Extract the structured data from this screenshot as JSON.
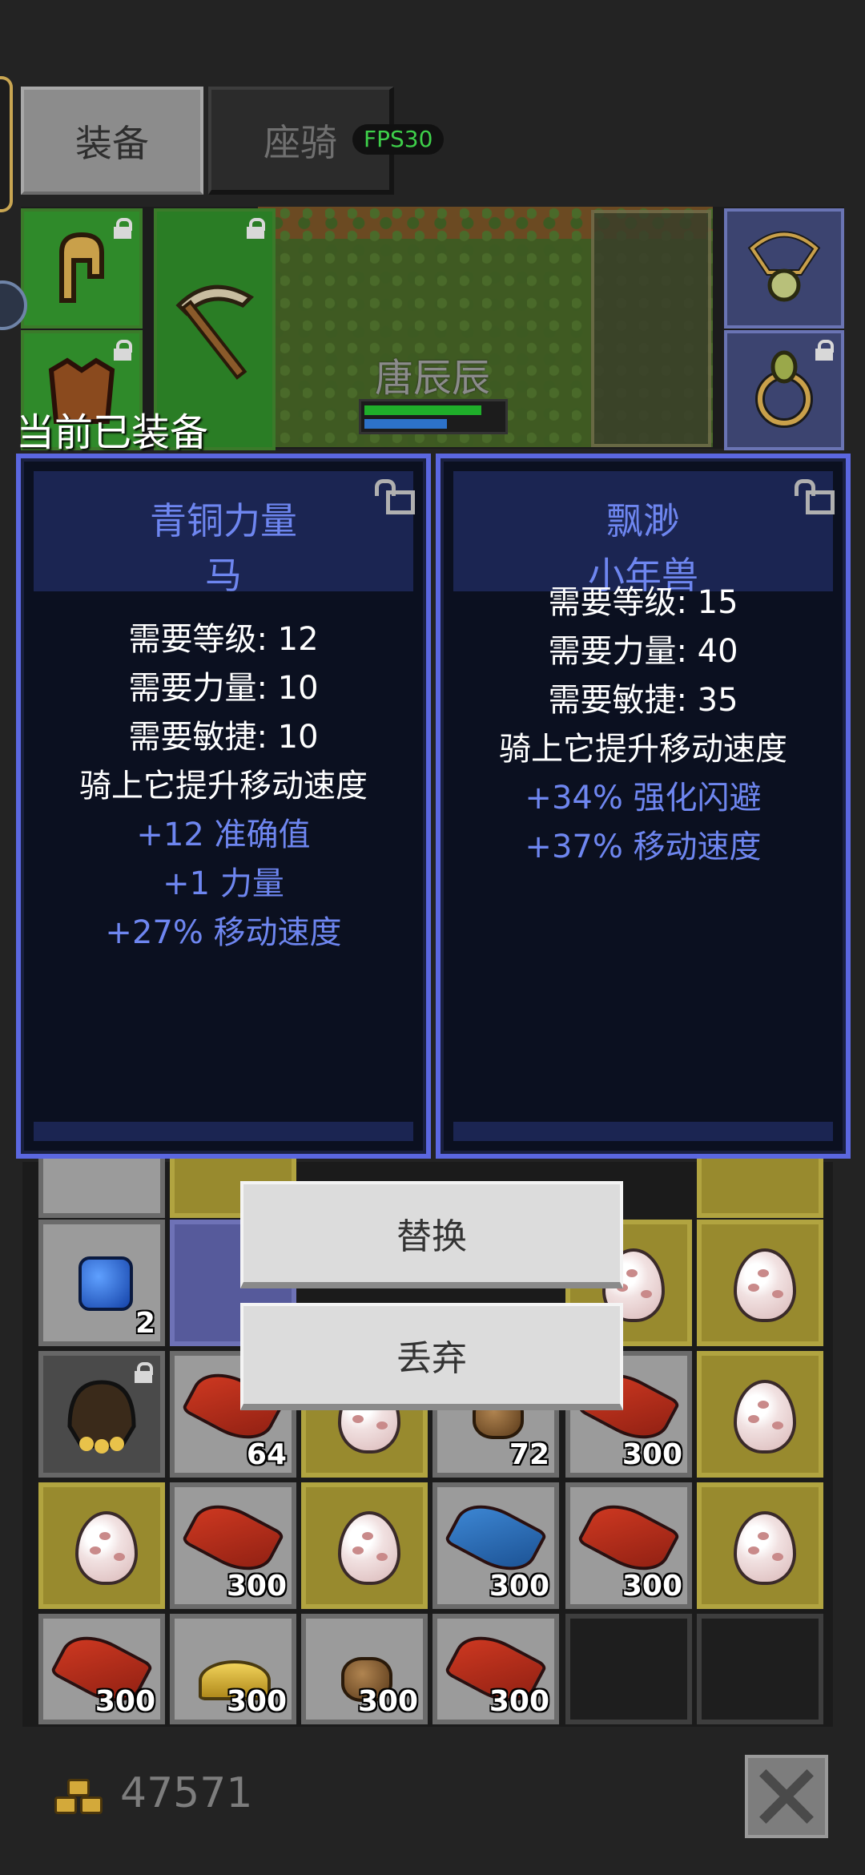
{
  "tabs": {
    "equip": "装备",
    "mount": "座骑"
  },
  "fps": "FPS30",
  "character": {
    "name": "唐辰辰",
    "hp_fraction": 0.85,
    "mp_fraction": 0.6
  },
  "equipped_label": "当前已装备",
  "cards": {
    "left": {
      "title_line1": "青铜力量",
      "title_line2": "马",
      "lines": [
        {
          "text": "需要等级: 12",
          "kind": "req"
        },
        {
          "text": "需要力量: 10",
          "kind": "req"
        },
        {
          "text": "需要敏捷: 10",
          "kind": "req"
        },
        {
          "text": "骑上它提升移动速度",
          "kind": "req"
        },
        {
          "text": "+12 准确值",
          "kind": "bonus"
        },
        {
          "text": "+1 力量",
          "kind": "bonus"
        },
        {
          "text": "+27% 移动速度",
          "kind": "bonus"
        }
      ]
    },
    "right": {
      "title_line1": "飘渺",
      "title_line2": "小年兽",
      "lines": [
        {
          "text": "需要等级: 15",
          "kind": "req"
        },
        {
          "text": "需要力量: 40",
          "kind": "req"
        },
        {
          "text": "需要敏捷: 35",
          "kind": "req"
        },
        {
          "text": "骑上它提升移动速度",
          "kind": "req"
        },
        {
          "text": "+34% 强化闪避",
          "kind": "bonus"
        },
        {
          "text": "+37% 移动速度",
          "kind": "bonus"
        }
      ]
    }
  },
  "actions": {
    "replace": "替换",
    "discard": "丢弃"
  },
  "inventory": {
    "counts": {
      "gem": "2",
      "c64": "64",
      "c72": "72",
      "c300": "300"
    }
  },
  "gold": "47571",
  "colors": {
    "card_border": "#5b67e0",
    "title_blue": "#6e86f0",
    "hp": "#1fae2a",
    "mp": "#2d72c9"
  }
}
